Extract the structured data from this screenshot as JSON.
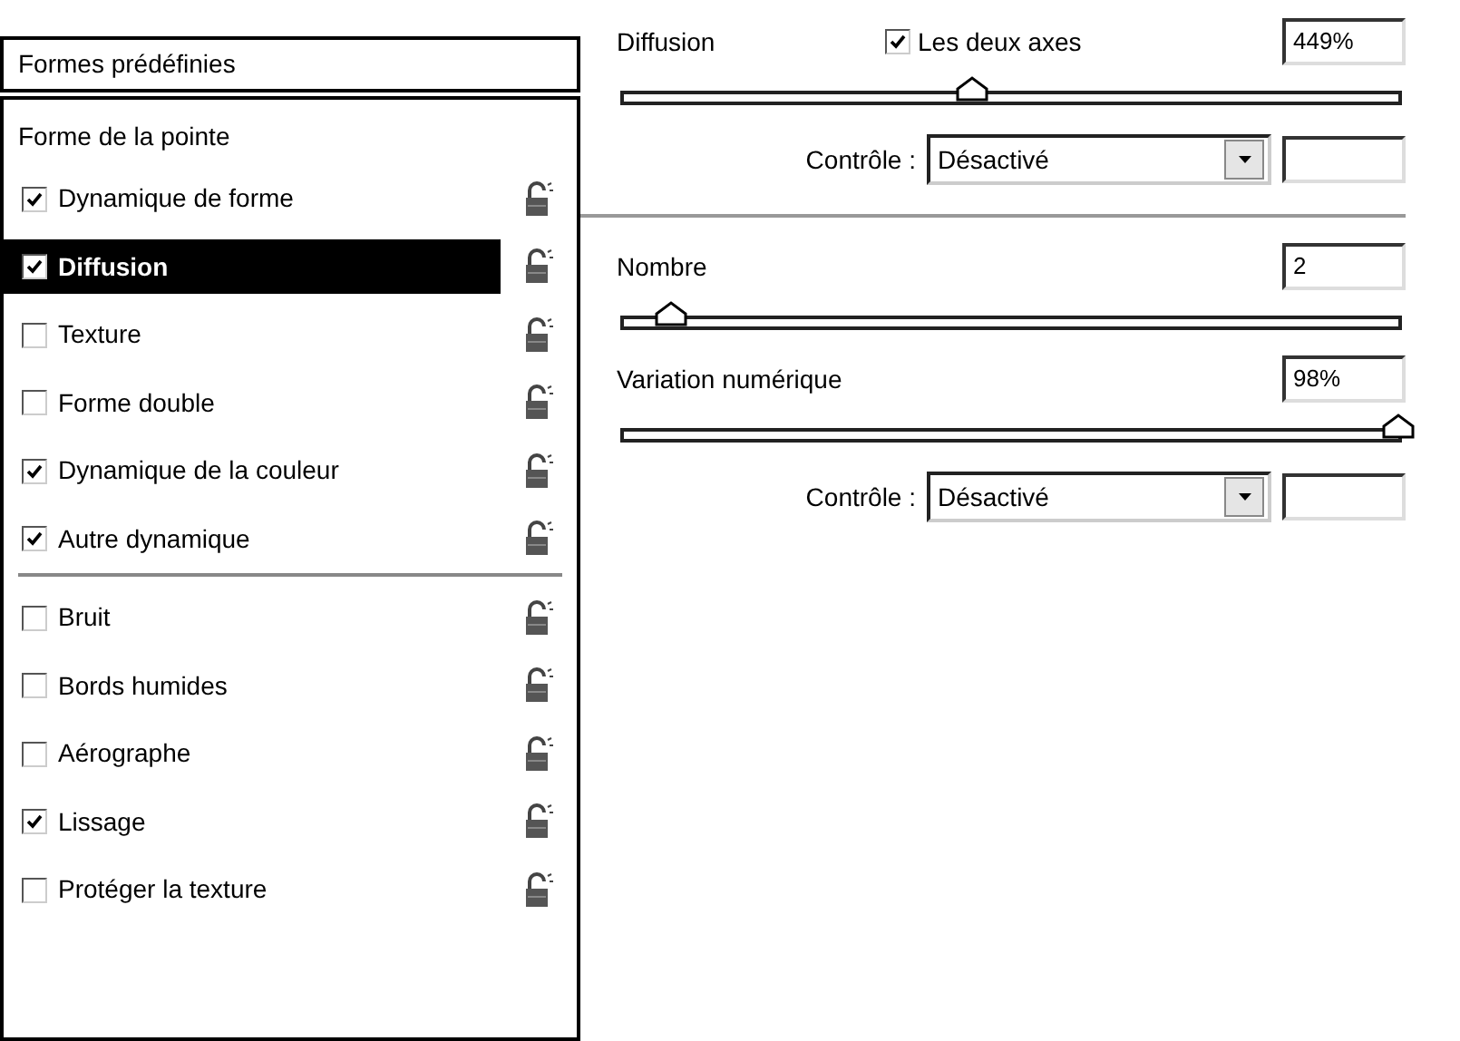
{
  "presets": {
    "label": "Formes prédéfinies"
  },
  "sidebar": {
    "header": "Forme de la pointe",
    "groups": [
      [
        {
          "label": "Dynamique de forme",
          "checked": true,
          "selected": false
        },
        {
          "label": "Diffusion",
          "checked": true,
          "selected": true
        },
        {
          "label": "Texture",
          "checked": false,
          "selected": false
        },
        {
          "label": "Forme double",
          "checked": false,
          "selected": false
        },
        {
          "label": "Dynamique de la couleur",
          "checked": true,
          "selected": false
        },
        {
          "label": "Autre dynamique",
          "checked": true,
          "selected": false
        }
      ],
      [
        {
          "label": "Bruit",
          "checked": false,
          "selected": false
        },
        {
          "label": "Bords humides",
          "checked": false,
          "selected": false
        },
        {
          "label": "Aérographe",
          "checked": false,
          "selected": false
        },
        {
          "label": "Lissage",
          "checked": true,
          "selected": false
        },
        {
          "label": "Protéger la texture",
          "checked": false,
          "selected": false
        }
      ]
    ]
  },
  "sections": [
    {
      "rows": [
        {
          "kind": "value",
          "label": "Diffusion",
          "checkbox": {
            "label": "Les deux axes",
            "checked": true
          },
          "value": "449%"
        },
        {
          "kind": "slider",
          "level": 0.45
        },
        {
          "kind": "control",
          "label": "Contrôle :",
          "select": "Désactivé"
        }
      ]
    },
    {
      "rows": [
        {
          "kind": "value",
          "label": "Nombre",
          "value": "2"
        },
        {
          "kind": "slider",
          "level": 0.06
        },
        {
          "kind": "value",
          "label": "Variation numérique",
          "value": "98%"
        },
        {
          "kind": "slider",
          "level": 1.0
        },
        {
          "kind": "control",
          "label": "Contrôle :",
          "select": "Désactivé"
        }
      ]
    }
  ]
}
